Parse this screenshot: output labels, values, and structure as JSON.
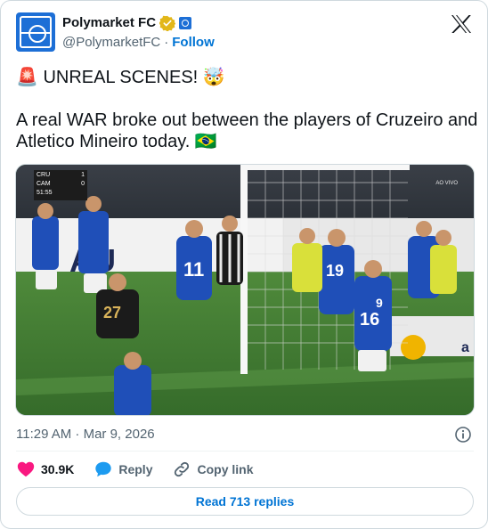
{
  "author": {
    "display_name": "Polymarket FC",
    "handle": "@PolymarketFC",
    "separator": "·",
    "follow_label": "Follow"
  },
  "tweet": {
    "line1_emoji": "🚨",
    "line1_text": "UNREAL SCENES!",
    "line1_emoji2": "🤯",
    "line2_text": "A real WAR broke out between the players of Cruzeiro and Atletico Mineiro today.",
    "line2_emoji": "🇧🇷"
  },
  "media": {
    "scoreboard": {
      "home_team": "CRU",
      "home_score": "1",
      "away_team": "CAM",
      "away_score": "0",
      "clock": "51:55"
    },
    "live_label": "AO VIVO",
    "jersey_numbers": [
      "11",
      "27",
      "19",
      "16",
      "9"
    ]
  },
  "meta": {
    "timestamp": "11:29 AM · Mar 9, 2026"
  },
  "actions": {
    "likes_count": "30.9K",
    "reply_label": "Reply",
    "copy_label": "Copy link"
  },
  "replies_button": "Read 713 replies",
  "colors": {
    "link_blue": "#0074d4",
    "like_red": "#f91880",
    "muted_gray": "#536471",
    "border": "#cfd9de",
    "cruzeiro_blue": "#1f4fb8"
  }
}
